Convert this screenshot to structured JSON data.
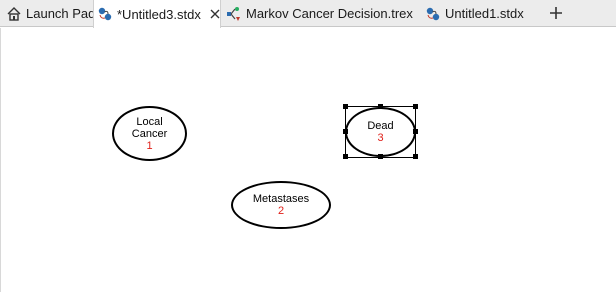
{
  "tabs": [
    {
      "label": "Launch Pad",
      "icon": "home-icon",
      "active": false
    },
    {
      "label": "*Untitled3.stdx",
      "icon": "state-diagram-icon",
      "active": true
    },
    {
      "label": "Markov Cancer Decision.trex",
      "icon": "tree-icon",
      "active": false
    },
    {
      "label": "Untitled1.stdx",
      "icon": "state-diagram-icon",
      "active": false
    }
  ],
  "nodes": [
    {
      "name": "Local\nCancer",
      "number": "1",
      "selected": false
    },
    {
      "name": "Dead",
      "number": "3",
      "selected": true
    },
    {
      "name": "Metastases",
      "number": "2",
      "selected": false
    }
  ],
  "colors": {
    "node_number": "#e0201a",
    "tabbar_bg": "#ececec",
    "node_border": "#000000"
  }
}
